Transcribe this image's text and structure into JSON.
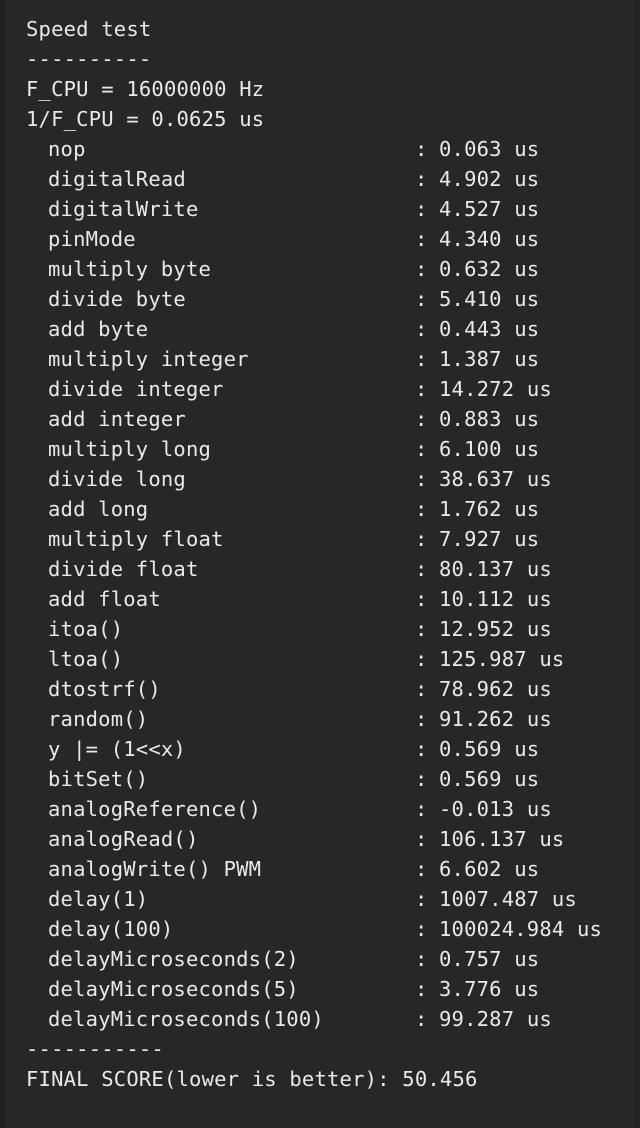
{
  "terminal": {
    "title": "Speed test",
    "divider_top": "----------",
    "divider_bottom": "-----------",
    "background_color": "#272727",
    "text_color": "#e9e9e9",
    "header_lines": [
      "F_CPU = 16000000 Hz",
      "1/F_CPU = 0.0625 us"
    ],
    "separator": ":",
    "unit": "us",
    "rows": [
      {
        "label": "nop",
        "value": "0.063",
        "unit": "us"
      },
      {
        "label": "digitalRead",
        "value": "4.902",
        "unit": "us"
      },
      {
        "label": "digitalWrite",
        "value": "4.527",
        "unit": "us"
      },
      {
        "label": "pinMode",
        "value": "4.340",
        "unit": "us"
      },
      {
        "label": "multiply byte",
        "value": "0.632",
        "unit": "us"
      },
      {
        "label": "divide byte",
        "value": "5.410",
        "unit": "us"
      },
      {
        "label": "add byte",
        "value": "0.443",
        "unit": "us"
      },
      {
        "label": "multiply integer",
        "value": "1.387",
        "unit": "us"
      },
      {
        "label": "divide integer",
        "value": "14.272",
        "unit": "us"
      },
      {
        "label": "add integer",
        "value": "0.883",
        "unit": "us"
      },
      {
        "label": "multiply long",
        "value": "6.100",
        "unit": "us"
      },
      {
        "label": "divide long",
        "value": "38.637",
        "unit": "us"
      },
      {
        "label": "add long",
        "value": "1.762",
        "unit": "us"
      },
      {
        "label": "multiply float",
        "value": "7.927",
        "unit": "us"
      },
      {
        "label": "divide float",
        "value": "80.137",
        "unit": "us"
      },
      {
        "label": "add float",
        "value": "10.112",
        "unit": "us"
      },
      {
        "label": "itoa()",
        "value": "12.952",
        "unit": "us"
      },
      {
        "label": "ltoa()",
        "value": "125.987",
        "unit": "us"
      },
      {
        "label": "dtostrf()",
        "value": "78.962",
        "unit": "us"
      },
      {
        "label": "random()",
        "value": "91.262",
        "unit": "us"
      },
      {
        "label": "y |= (1<<x)",
        "value": "0.569",
        "unit": "us"
      },
      {
        "label": "bitSet()",
        "value": "0.569",
        "unit": "us"
      },
      {
        "label": "analogReference()",
        "value": "-0.013",
        "unit": "us"
      },
      {
        "label": "analogRead()",
        "value": "106.137",
        "unit": "us"
      },
      {
        "label": "analogWrite() PWM",
        "value": "6.602",
        "unit": "us"
      },
      {
        "label": "delay(1)",
        "value": "1007.487",
        "unit": "us"
      },
      {
        "label": "delay(100)",
        "value": "100024.984",
        "unit": "us"
      },
      {
        "label": "delayMicroseconds(2)",
        "value": "0.757",
        "unit": "us"
      },
      {
        "label": "delayMicroseconds(5)",
        "value": "3.776",
        "unit": "us"
      },
      {
        "label": "delayMicroseconds(100)",
        "value": "99.287",
        "unit": "us"
      }
    ],
    "final_score_label": "FINAL SCORE(lower is better):",
    "final_score_value": "50.456"
  }
}
